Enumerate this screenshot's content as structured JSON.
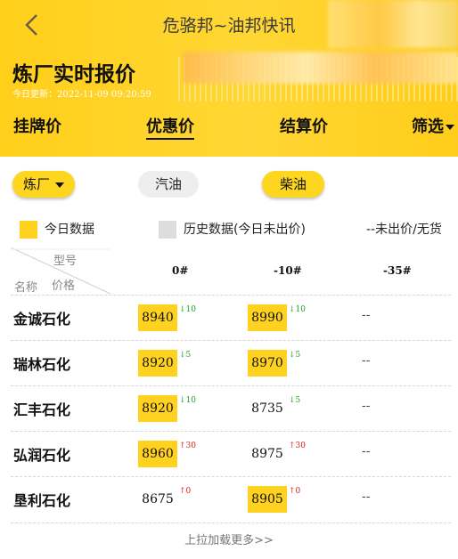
{
  "header": {
    "title": "危骆邦~油邦快讯",
    "page_title": "炼厂实时报价",
    "update_label": "今日更新：",
    "update_time": "2022-11-09 09:20:59"
  },
  "tabs": [
    {
      "label": "挂牌价",
      "active": false
    },
    {
      "label": "优惠价",
      "active": true
    },
    {
      "label": "结算价",
      "active": false
    },
    {
      "label": "筛选",
      "active": false
    }
  ],
  "filters": {
    "refinery": "炼厂",
    "gasoline": "汽油",
    "diesel": "柴油"
  },
  "legend": {
    "today": "今日数据",
    "history": "历史数据(今日未出价)",
    "none": "--未出价/无货"
  },
  "table": {
    "corner_type": "型号",
    "corner_name": "名称",
    "corner_price": "价格",
    "columns": [
      "0#",
      "-10#",
      "-35#"
    ],
    "rows": [
      {
        "name": "金诚石化",
        "p0": "8940",
        "p0_type": "today",
        "c0": "10",
        "c0_dir": "down",
        "p10": "8990",
        "p10_type": "today",
        "c10": "10",
        "c10_dir": "down",
        "p35": "--"
      },
      {
        "name": "瑞林石化",
        "p0": "8920",
        "p0_type": "today",
        "c0": "5",
        "c0_dir": "down",
        "p10": "8970",
        "p10_type": "today",
        "c10": "5",
        "c10_dir": "down",
        "p35": "--"
      },
      {
        "name": "汇丰石化",
        "p0": "8920",
        "p0_type": "today",
        "c0": "10",
        "c0_dir": "down",
        "p10": "8735",
        "p10_type": "history",
        "c10": "5",
        "c10_dir": "down",
        "p35": "--"
      },
      {
        "name": "弘润石化",
        "p0": "8960",
        "p0_type": "today",
        "c0": "30",
        "c0_dir": "up",
        "p10": "8975",
        "p10_type": "history",
        "c10": "30",
        "c10_dir": "up",
        "p35": "--"
      },
      {
        "name": "垦利石化",
        "p0": "8675",
        "p0_type": "history",
        "c0": "0",
        "c0_dir": "up",
        "p10": "8905",
        "p10_type": "today",
        "c10": "0",
        "c10_dir": "up",
        "p35": "--"
      }
    ]
  },
  "footer": {
    "load_more": "上拉加载更多>>"
  },
  "colors": {
    "accent": "#ffd21f",
    "history": "#dddddd",
    "up": "#e02020",
    "down": "#21a021"
  }
}
